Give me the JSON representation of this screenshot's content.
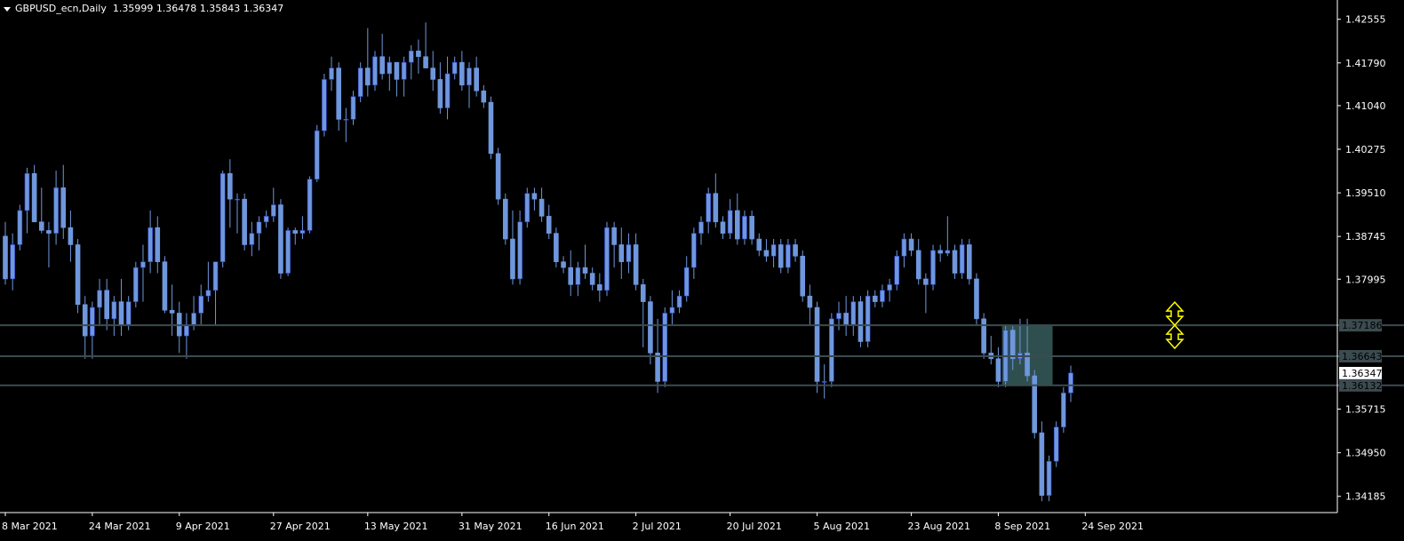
{
  "header": {
    "symbol": "GBPUSD_ecn,Daily",
    "ohlc": "1.35999 1.36478 1.35843 1.36347"
  },
  "colors": {
    "background": "#000000",
    "candle": "#6f97dc",
    "candle_dark": "#2b43c9",
    "axis": "#ffffff",
    "level_line": "#3b4b50",
    "zone": "#2f4f4f",
    "arrow": "#ffff00",
    "price_label_bg": "#ffffff"
  },
  "icons": {
    "up_arrow": "double-arrow-up-icon",
    "down_arrow": "double-arrow-down-icon",
    "header_menu": "triangle-down-icon"
  },
  "chart_data": {
    "type": "candlestick",
    "title": "GBPUSD_ecn,Daily",
    "y_ticks": [
      "1.42555",
      "1.41790",
      "1.41040",
      "1.40275",
      "1.39510",
      "1.38745",
      "1.37995",
      "1.37186",
      "1.36643",
      "1.36347",
      "1.36132",
      "1.35715",
      "1.34950",
      "1.34185"
    ],
    "x_ticks": [
      "8 Mar 2021",
      "24 Mar 2021",
      "9 Apr 2021",
      "27 Apr 2021",
      "13 May 2021",
      "31 May 2021",
      "16 Jun 2021",
      "2 Jul 2021",
      "20 Jul 2021",
      "5 Aug 2021",
      "23 Aug 2021",
      "8 Sep 2021",
      "24 Sep 2021"
    ],
    "ylim": [
      1.339,
      1.428
    ],
    "horizontal_levels": [
      1.37186,
      1.36643,
      1.36132
    ],
    "current_price": 1.36347,
    "zone": {
      "from": "14 Sep 2021",
      "to": "21 Sep 2021",
      "high": 1.37186,
      "low": 1.36132
    },
    "ohlc": [
      [
        1.3875,
        1.39,
        1.379,
        1.38
      ],
      [
        1.38,
        1.388,
        1.378,
        1.386
      ],
      [
        1.386,
        1.393,
        1.385,
        1.392
      ],
      [
        1.392,
        1.3995,
        1.388,
        1.3985
      ],
      [
        1.3985,
        1.4,
        1.39,
        1.39
      ],
      [
        1.39,
        1.396,
        1.388,
        1.3885
      ],
      [
        1.3885,
        1.39,
        1.382,
        1.388
      ],
      [
        1.388,
        1.399,
        1.386,
        1.396
      ],
      [
        1.396,
        1.4,
        1.387,
        1.389
      ],
      [
        1.389,
        1.392,
        1.383,
        1.386
      ],
      [
        1.386,
        1.387,
        1.374,
        1.3755
      ],
      [
        1.3755,
        1.377,
        1.366,
        1.37
      ],
      [
        1.37,
        1.376,
        1.366,
        1.375
      ],
      [
        1.375,
        1.38,
        1.372,
        1.378
      ],
      [
        1.378,
        1.38,
        1.371,
        1.373
      ],
      [
        1.373,
        1.377,
        1.37,
        1.376
      ],
      [
        1.376,
        1.38,
        1.37,
        1.372
      ],
      [
        1.372,
        1.377,
        1.371,
        1.376
      ],
      [
        1.376,
        1.383,
        1.375,
        1.382
      ],
      [
        1.382,
        1.386,
        1.376,
        1.383
      ],
      [
        1.383,
        1.392,
        1.381,
        1.389
      ],
      [
        1.389,
        1.391,
        1.381,
        1.383
      ],
      [
        1.383,
        1.384,
        1.374,
        1.3745
      ],
      [
        1.3745,
        1.379,
        1.37,
        1.374
      ],
      [
        1.374,
        1.376,
        1.367,
        1.37
      ],
      [
        1.37,
        1.374,
        1.366,
        1.372
      ],
      [
        1.372,
        1.377,
        1.371,
        1.374
      ],
      [
        1.374,
        1.379,
        1.372,
        1.377
      ],
      [
        1.377,
        1.383,
        1.376,
        1.378
      ],
      [
        1.378,
        1.383,
        1.372,
        1.383
      ],
      [
        1.383,
        1.399,
        1.382,
        1.3985
      ],
      [
        1.3985,
        1.401,
        1.389,
        1.394
      ],
      [
        1.394,
        1.395,
        1.388,
        1.394
      ],
      [
        1.394,
        1.395,
        1.385,
        1.386
      ],
      [
        1.386,
        1.39,
        1.384,
        1.388
      ],
      [
        1.388,
        1.391,
        1.385,
        1.39
      ],
      [
        1.39,
        1.392,
        1.389,
        1.391
      ],
      [
        1.391,
        1.396,
        1.39,
        1.393
      ],
      [
        1.393,
        1.394,
        1.38,
        1.381
      ],
      [
        1.381,
        1.389,
        1.3805,
        1.3885
      ],
      [
        1.3885,
        1.389,
        1.386,
        1.388
      ],
      [
        1.388,
        1.391,
        1.387,
        1.3885
      ],
      [
        1.3885,
        1.398,
        1.388,
        1.3975
      ],
      [
        1.3975,
        1.407,
        1.397,
        1.406
      ],
      [
        1.406,
        1.416,
        1.405,
        1.415
      ],
      [
        1.415,
        1.419,
        1.413,
        1.417
      ],
      [
        1.417,
        1.418,
        1.406,
        1.408
      ],
      [
        1.408,
        1.41,
        1.404,
        1.408
      ],
      [
        1.408,
        1.413,
        1.407,
        1.412
      ],
      [
        1.412,
        1.418,
        1.411,
        1.417
      ],
      [
        1.417,
        1.424,
        1.412,
        1.414
      ],
      [
        1.414,
        1.42,
        1.413,
        1.419
      ],
      [
        1.419,
        1.423,
        1.415,
        1.416
      ],
      [
        1.416,
        1.419,
        1.413,
        1.418
      ],
      [
        1.418,
        1.418,
        1.412,
        1.415
      ],
      [
        1.415,
        1.419,
        1.412,
        1.418
      ],
      [
        1.418,
        1.421,
        1.415,
        1.42
      ],
      [
        1.42,
        1.422,
        1.416,
        1.419
      ],
      [
        1.419,
        1.425,
        1.417,
        1.417
      ],
      [
        1.417,
        1.42,
        1.413,
        1.415
      ],
      [
        1.415,
        1.418,
        1.409,
        1.41
      ],
      [
        1.41,
        1.419,
        1.408,
        1.416
      ],
      [
        1.416,
        1.419,
        1.415,
        1.418
      ],
      [
        1.418,
        1.42,
        1.413,
        1.414
      ],
      [
        1.414,
        1.418,
        1.41,
        1.417
      ],
      [
        1.417,
        1.419,
        1.412,
        1.413
      ],
      [
        1.413,
        1.414,
        1.41,
        1.411
      ],
      [
        1.411,
        1.412,
        1.401,
        1.402
      ],
      [
        1.402,
        1.403,
        1.393,
        1.394
      ],
      [
        1.394,
        1.395,
        1.386,
        1.387
      ],
      [
        1.387,
        1.392,
        1.379,
        1.38
      ],
      [
        1.38,
        1.392,
        1.379,
        1.39
      ],
      [
        1.39,
        1.396,
        1.389,
        1.395
      ],
      [
        1.395,
        1.396,
        1.392,
        1.394
      ],
      [
        1.394,
        1.396,
        1.39,
        1.391
      ],
      [
        1.391,
        1.393,
        1.387,
        1.388
      ],
      [
        1.388,
        1.389,
        1.382,
        1.383
      ],
      [
        1.383,
        1.384,
        1.381,
        1.382
      ],
      [
        1.382,
        1.385,
        1.377,
        1.379
      ],
      [
        1.379,
        1.383,
        1.377,
        1.382
      ],
      [
        1.382,
        1.386,
        1.38,
        1.381
      ],
      [
        1.381,
        1.382,
        1.378,
        1.379
      ],
      [
        1.379,
        1.381,
        1.376,
        1.378
      ],
      [
        1.378,
        1.39,
        1.377,
        1.389
      ],
      [
        1.389,
        1.39,
        1.382,
        1.386
      ],
      [
        1.386,
        1.389,
        1.38,
        1.383
      ],
      [
        1.383,
        1.388,
        1.381,
        1.386
      ],
      [
        1.386,
        1.388,
        1.378,
        1.379
      ],
      [
        1.379,
        1.38,
        1.368,
        1.376
      ],
      [
        1.376,
        1.377,
        1.365,
        1.367
      ],
      [
        1.367,
        1.373,
        1.36,
        1.362
      ],
      [
        1.362,
        1.375,
        1.361,
        1.374
      ],
      [
        1.374,
        1.378,
        1.372,
        1.375
      ],
      [
        1.375,
        1.378,
        1.374,
        1.377
      ],
      [
        1.377,
        1.384,
        1.376,
        1.382
      ],
      [
        1.382,
        1.389,
        1.38,
        1.388
      ],
      [
        1.388,
        1.391,
        1.386,
        1.39
      ],
      [
        1.39,
        1.396,
        1.388,
        1.395
      ],
      [
        1.395,
        1.3985,
        1.389,
        1.39
      ],
      [
        1.39,
        1.391,
        1.387,
        1.388
      ],
      [
        1.388,
        1.394,
        1.387,
        1.392
      ],
      [
        1.392,
        1.395,
        1.386,
        1.387
      ],
      [
        1.387,
        1.392,
        1.386,
        1.391
      ],
      [
        1.391,
        1.392,
        1.386,
        1.387
      ],
      [
        1.387,
        1.388,
        1.384,
        1.385
      ],
      [
        1.385,
        1.387,
        1.383,
        1.384
      ],
      [
        1.384,
        1.387,
        1.382,
        1.386
      ],
      [
        1.386,
        1.387,
        1.381,
        1.382
      ],
      [
        1.382,
        1.387,
        1.381,
        1.386
      ],
      [
        1.386,
        1.387,
        1.383,
        1.384
      ],
      [
        1.384,
        1.385,
        1.376,
        1.377
      ],
      [
        1.377,
        1.379,
        1.372,
        1.375
      ],
      [
        1.375,
        1.376,
        1.36,
        1.362
      ],
      [
        1.362,
        1.365,
        1.359,
        1.362
      ],
      [
        1.362,
        1.374,
        1.361,
        1.373
      ],
      [
        1.373,
        1.376,
        1.371,
        1.374
      ],
      [
        1.374,
        1.377,
        1.37,
        1.372
      ],
      [
        1.372,
        1.377,
        1.37,
        1.376
      ],
      [
        1.376,
        1.377,
        1.368,
        1.369
      ],
      [
        1.369,
        1.378,
        1.368,
        1.377
      ],
      [
        1.377,
        1.378,
        1.375,
        1.376
      ],
      [
        1.376,
        1.379,
        1.375,
        1.378
      ],
      [
        1.378,
        1.38,
        1.376,
        1.379
      ],
      [
        1.379,
        1.385,
        1.378,
        1.384
      ],
      [
        1.384,
        1.388,
        1.382,
        1.387
      ],
      [
        1.387,
        1.388,
        1.384,
        1.385
      ],
      [
        1.385,
        1.387,
        1.379,
        1.38
      ],
      [
        1.38,
        1.381,
        1.374,
        1.379
      ],
      [
        1.379,
        1.386,
        1.378,
        1.385
      ],
      [
        1.385,
        1.386,
        1.383,
        1.3845
      ],
      [
        1.3845,
        1.391,
        1.384,
        1.385
      ],
      [
        1.385,
        1.386,
        1.38,
        1.381
      ],
      [
        1.381,
        1.387,
        1.38,
        1.386
      ],
      [
        1.386,
        1.387,
        1.379,
        1.38
      ],
      [
        1.38,
        1.381,
        1.372,
        1.373
      ],
      [
        1.373,
        1.374,
        1.366,
        1.367
      ],
      [
        1.367,
        1.37,
        1.365,
        1.366
      ],
      [
        1.366,
        1.368,
        1.361,
        1.362
      ],
      [
        1.362,
        1.372,
        1.361,
        1.371
      ],
      [
        1.371,
        1.372,
        1.364,
        1.366
      ],
      [
        1.366,
        1.373,
        1.365,
        1.367
      ],
      [
        1.367,
        1.373,
        1.362,
        1.363
      ],
      [
        1.363,
        1.364,
        1.352,
        1.353
      ],
      [
        1.353,
        1.355,
        1.341,
        1.342
      ],
      [
        1.342,
        1.349,
        1.341,
        1.348
      ],
      [
        1.348,
        1.355,
        1.347,
        1.354
      ],
      [
        1.354,
        1.361,
        1.353,
        1.36
      ],
      [
        1.36,
        1.3648,
        1.3584,
        1.3635
      ]
    ],
    "x_tick_positions": [
      0,
      12,
      24,
      37,
      50,
      63,
      75,
      87,
      100,
      112,
      125,
      137,
      149
    ]
  }
}
